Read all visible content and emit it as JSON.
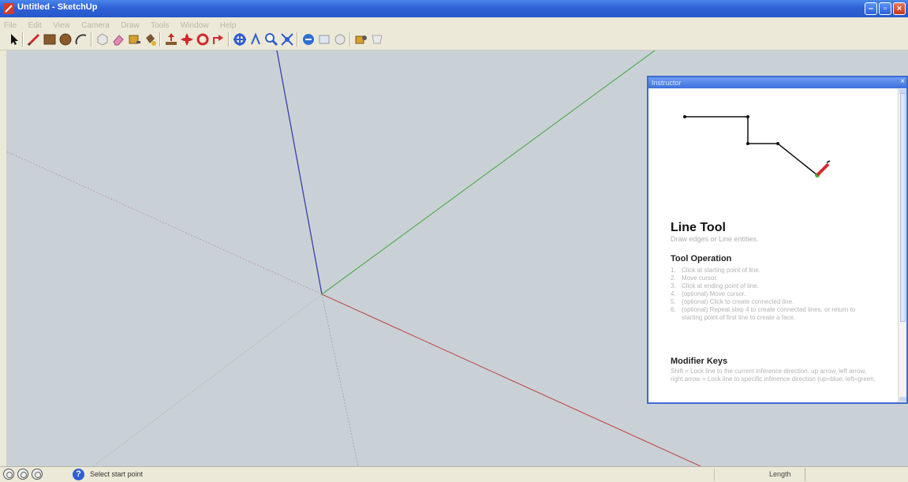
{
  "window": {
    "title": "Untitled - SketchUp",
    "controls": [
      "minimize",
      "maximize",
      "close"
    ]
  },
  "menu": {
    "items": [
      "File",
      "Edit",
      "View",
      "Camera",
      "Draw",
      "Tools",
      "Window",
      "Help"
    ]
  },
  "toolbar": {
    "tools": [
      {
        "name": "select",
        "icon": "arrow-cursor-icon"
      },
      {
        "name": "line",
        "icon": "pencil-icon"
      },
      {
        "name": "rectangle",
        "icon": "rectangle-icon"
      },
      {
        "name": "circle",
        "icon": "circle-icon"
      },
      {
        "name": "arc",
        "icon": "arc-icon"
      },
      {
        "name": "make-component",
        "icon": "component-icon"
      },
      {
        "name": "eraser",
        "icon": "eraser-icon"
      },
      {
        "name": "tape-measure",
        "icon": "tape-measure-icon"
      },
      {
        "name": "paint-bucket",
        "icon": "paint-bucket-icon"
      },
      {
        "name": "push-pull",
        "icon": "push-pull-icon"
      },
      {
        "name": "move",
        "icon": "move-icon"
      },
      {
        "name": "rotate",
        "icon": "rotate-icon"
      },
      {
        "name": "offset",
        "icon": "offset-icon"
      },
      {
        "name": "orbit",
        "icon": "orbit-icon"
      },
      {
        "name": "pan",
        "icon": "pan-icon"
      },
      {
        "name": "zoom",
        "icon": "zoom-icon"
      },
      {
        "name": "zoom-extents",
        "icon": "zoom-extents-icon"
      },
      {
        "name": "get-models",
        "icon": "get-models-icon"
      },
      {
        "name": "share-model",
        "icon": "share-model-icon"
      },
      {
        "name": "get-photo-texture",
        "icon": "photo-texture-icon"
      },
      {
        "name": "component-browser",
        "icon": "components-browser-icon"
      },
      {
        "name": "extension-warehouse",
        "icon": "extension-icon"
      }
    ]
  },
  "viewport": {
    "background": "#c9d1d6",
    "axis_colors": {
      "red": "#c24a4a",
      "green": "#4faa4a",
      "blue": "#3b3fa8"
    }
  },
  "instructor": {
    "panel_title": "Instructor",
    "tool_name": "Line Tool",
    "tool_description": "Draw edges or Line entities.",
    "operation_heading": "Tool Operation",
    "steps": [
      {
        "num": "1.",
        "text": "Click at starting point of line."
      },
      {
        "num": "2.",
        "text": "Move cursor."
      },
      {
        "num": "3.",
        "text": "Click at ending point of line."
      },
      {
        "num": "4.",
        "text": "(optional) Move cursor."
      },
      {
        "num": "5.",
        "text": "(optional) Click to create connected line."
      },
      {
        "num": "6.",
        "text": "(optional) Repeat step 4 to create connected lines, or return to starting point of first line to create a face."
      }
    ],
    "modifier_heading": "Modifier Keys",
    "modifier_text": "Shift = Lock line to the current inference direction. up arrow, left arrow, right arrow = Lock line to specific inference direction (up=blue, left=green,"
  },
  "status": {
    "message": "Select start point",
    "measurement_label": "Length",
    "measurement_value": ""
  }
}
